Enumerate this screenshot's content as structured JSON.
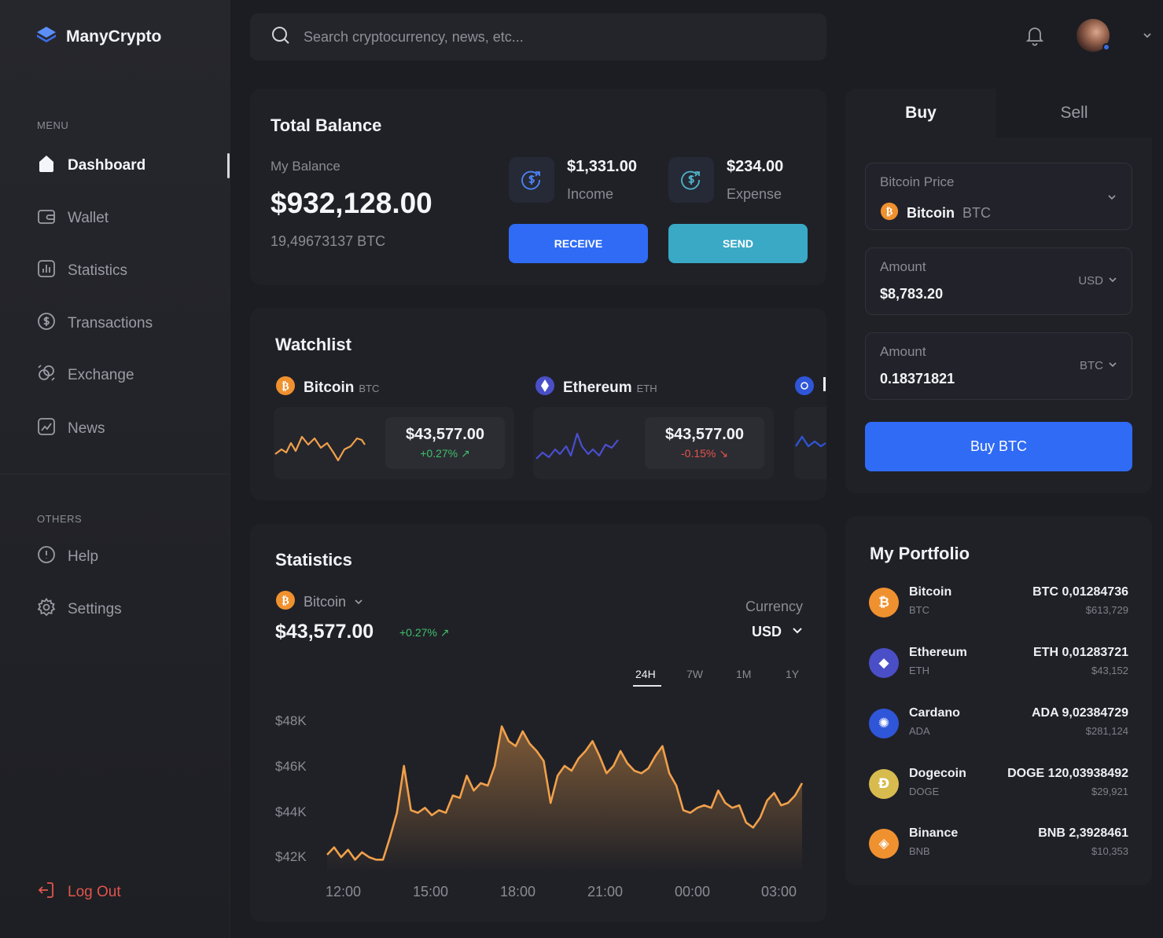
{
  "brand": {
    "name": "ManyCrypto"
  },
  "sidebar": {
    "menu_label": "MENU",
    "menu": [
      {
        "label": "Dashboard",
        "icon": "home-icon",
        "active": true
      },
      {
        "label": "Wallet",
        "icon": "wallet-icon"
      },
      {
        "label": "Statistics",
        "icon": "statistics-icon"
      },
      {
        "label": "Transactions",
        "icon": "dollar-circle-icon"
      },
      {
        "label": "Exchange",
        "icon": "exchange-icon"
      },
      {
        "label": "News",
        "icon": "news-icon"
      }
    ],
    "others_label": "OTHERS",
    "others": [
      {
        "label": "Help",
        "icon": "info-icon"
      },
      {
        "label": "Settings",
        "icon": "gear-icon"
      }
    ],
    "logout_label": "Log Out"
  },
  "search": {
    "placeholder": "Search cryptocurrency, news, etc..."
  },
  "balance": {
    "title": "Total Balance",
    "my_balance_label": "My Balance",
    "amount": "$932,128.00",
    "btc": "19,49673137 BTC",
    "income_value": "$1,331.00",
    "income_label": "Income",
    "expense_value": "$234.00",
    "expense_label": "Expense",
    "receive_label": "RECEIVE",
    "send_label": "SEND"
  },
  "watchlist": {
    "title": "Watchlist",
    "items": [
      {
        "name": "Bitcoin",
        "symbol": "BTC",
        "price": "$43,577.00",
        "change": "+0.27%",
        "trend": "up"
      },
      {
        "name": "Ethereum",
        "symbol": "ETH",
        "price": "$43,577.00",
        "change": "-0.15%",
        "trend": "down"
      }
    ]
  },
  "statistics": {
    "title": "Statistics",
    "coin": "Bitcoin",
    "price": "$43,577.00",
    "change": "+0.27%",
    "currency_label": "Currency",
    "currency": "USD",
    "timeframes": [
      "24H",
      "7W",
      "1M",
      "1Y"
    ],
    "active_timeframe": "24H"
  },
  "trade": {
    "tab_buy": "Buy",
    "tab_sell": "Sell",
    "price_label": "Bitcoin Price",
    "coin_name": "Bitcoin",
    "coin_symbol": "BTC",
    "amount_label_1": "Amount",
    "amount_value_1": "$8,783.20",
    "amount_currency_1": "USD",
    "amount_label_2": "Amount",
    "amount_value_2": "0.18371821",
    "amount_currency_2": "BTC",
    "buy_button": "Buy BTC"
  },
  "portfolio": {
    "title": "My Portfolio",
    "items": [
      {
        "name": "Bitcoin",
        "symbol": "BTC",
        "amount": "BTC 0,01284736",
        "usd": "$613,729",
        "color": "#f0912f",
        "glyph": "₿"
      },
      {
        "name": "Ethereum",
        "symbol": "ETH",
        "amount": "ETH 0,01283721",
        "usd": "$43,152",
        "color": "#4a4fc7",
        "glyph": "◆"
      },
      {
        "name": "Cardano",
        "symbol": "ADA",
        "amount": "ADA 9,02384729",
        "usd": "$281,124",
        "color": "#2f56d9",
        "glyph": "✺"
      },
      {
        "name": "Dogecoin",
        "symbol": "DOGE",
        "amount": "DOGE 120,03938492",
        "usd": "$29,921",
        "color": "#d8bb4e",
        "glyph": "Ð"
      },
      {
        "name": "Binance",
        "symbol": "BNB",
        "amount": "BNB 2,3928461",
        "usd": "$10,353",
        "color": "#f0912f",
        "glyph": "◈"
      }
    ]
  },
  "colors": {
    "accent_blue": "#2f6bf5",
    "accent_teal": "#3aa9c6",
    "chart_orange": "#f0a04b",
    "up_green": "#3fbf6b",
    "down_red": "#e3534b"
  },
  "chart_data": {
    "type": "area",
    "x": [
      "12:00",
      "15:00",
      "18:00",
      "21:00",
      "00:00",
      "03:00"
    ],
    "yticks": [
      "$48K",
      "$46K",
      "$44K",
      "$42K"
    ],
    "ylim": [
      41500,
      48500
    ],
    "series": [
      {
        "values": [
          42200,
          42500,
          42100,
          42400,
          42000,
          42300,
          42100,
          42000,
          42000,
          42900,
          43900,
          45800,
          44000,
          43900,
          44100,
          43800,
          44000,
          43900,
          44600,
          44500,
          45400,
          44800,
          45100,
          45000,
          45800,
          47400,
          46800,
          46600,
          47200,
          46700,
          46400,
          46000,
          44300,
          45400,
          45800,
          45600,
          46100,
          46400,
          46800,
          46200,
          45500,
          45800,
          46400,
          45900,
          45600,
          45500,
          45700,
          46200,
          46600,
          45500,
          45000,
          44000,
          43900,
          44100,
          44200,
          44100,
          44800,
          44300,
          44100,
          44200,
          43500,
          43300,
          43700,
          44400,
          44700,
          44200,
          44300,
          44600,
          45100
        ]
      }
    ]
  }
}
